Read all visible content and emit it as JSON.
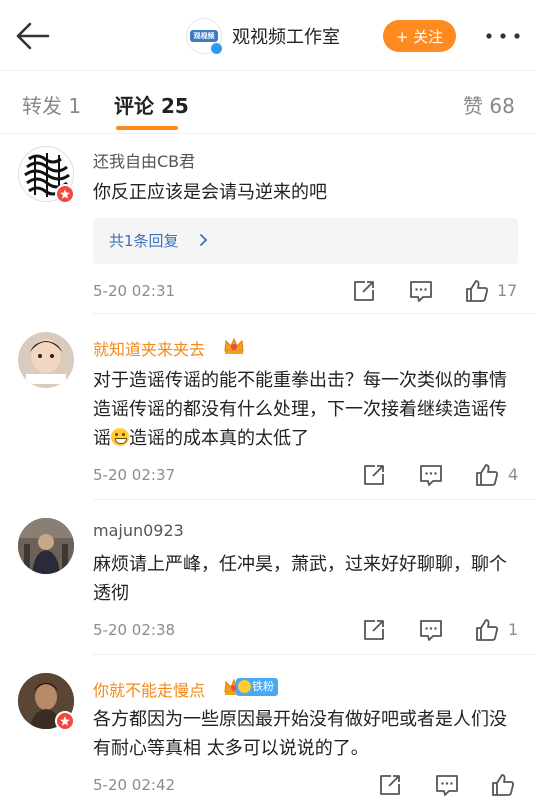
{
  "header": {
    "account_name": "观视频工作室",
    "logo_text": "观视频",
    "follow_label": "+ 关注",
    "more_icon": "more-dots-icon",
    "back_icon": "back-arrow-icon",
    "accent_color": "#ff8a1f"
  },
  "tabs": [
    {
      "label": "转发 1"
    },
    {
      "label": "评论 25"
    },
    {
      "label": "赞 68"
    }
  ],
  "comments": [
    {
      "username": "还我自由CB君",
      "text": "你反正应该是会请马逆来的吧",
      "reply_label": "共1条回复",
      "time": "5-20 02:31",
      "likes": "17"
    },
    {
      "username": "就知道夹来夹去",
      "text_a": "对于造谣传谣的能不能重拳出击？每一次类似的事情造谣传谣的都没有什么处理，下一次接着继续造谣传谣",
      "text_b": "造谣的成本真的太低了",
      "time": "5-20 02:37",
      "likes": "4"
    },
    {
      "username": "majun0923",
      "text": "麻烦请上严峰，任冲昊，萧武，过来好好聊聊，聊个透彻",
      "time": "5-20 02:38",
      "likes": "1"
    },
    {
      "username": "你就不能走慢点",
      "badge": "铁粉",
      "text": "各方都因为一些原因最开始没有做好吧或者是人们没有耐心等真相 太多可以说说的了。",
      "time": "5-20 02:42",
      "likes": ""
    }
  ]
}
